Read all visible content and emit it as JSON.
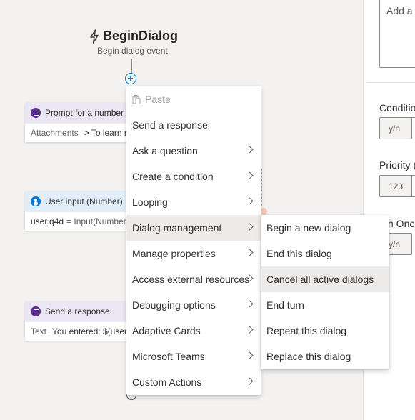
{
  "trigger": {
    "title": "BeginDialog",
    "subtitle": "Begin dialog event",
    "icon": "lightning-icon"
  },
  "nodes": [
    {
      "title": "Prompt for a number",
      "body_label": "Attachments",
      "body_value": "> To learn r",
      "icon": "message-icon",
      "color": "#5c2d91"
    },
    {
      "title": "User input (Number)",
      "body_label": "user.q4d",
      "body_value": "= Input(Number",
      "icon": "user-icon",
      "color": "#0078d4"
    },
    {
      "title": "Send a response",
      "body_label": "Text",
      "body_value": "You entered: ${user.q",
      "icon": "message-icon",
      "color": "#5c2d91"
    }
  ],
  "context_menu": {
    "items": [
      {
        "label": "Paste",
        "disabled": true,
        "has_submenu": false
      },
      {
        "label": "Send a response",
        "has_submenu": false
      },
      {
        "label": "Ask a question",
        "has_submenu": true
      },
      {
        "label": "Create a condition",
        "has_submenu": true
      },
      {
        "label": "Looping",
        "has_submenu": true
      },
      {
        "label": "Dialog management",
        "has_submenu": true,
        "highlighted": true
      },
      {
        "label": "Manage properties",
        "has_submenu": true
      },
      {
        "label": "Access external resources",
        "has_submenu": true
      },
      {
        "label": "Debugging options",
        "has_submenu": true
      },
      {
        "label": "Adaptive Cards",
        "has_submenu": true
      },
      {
        "label": "Microsoft Teams",
        "has_submenu": true
      },
      {
        "label": "Custom Actions",
        "has_submenu": true
      }
    ]
  },
  "submenu": {
    "items": [
      {
        "label": "Begin a new dialog"
      },
      {
        "label": "End this dialog"
      },
      {
        "label": "Cancel all active dialogs",
        "highlighted": true
      },
      {
        "label": "End turn"
      },
      {
        "label": "Repeat this dialog"
      },
      {
        "label": "Replace this dialog"
      }
    ]
  },
  "right_pane": {
    "textarea_placeholder": "Add a",
    "condition_label": "Conditio",
    "condition_value": "y/n",
    "priority_label": "Priority (",
    "priority_value": "123",
    "run_once_label": "n Onc",
    "run_once_value": "y/n"
  },
  "colors": {
    "accent": "#0078d4",
    "menu_highlight": "#edebe9",
    "canvas": "#f3f2f1"
  }
}
